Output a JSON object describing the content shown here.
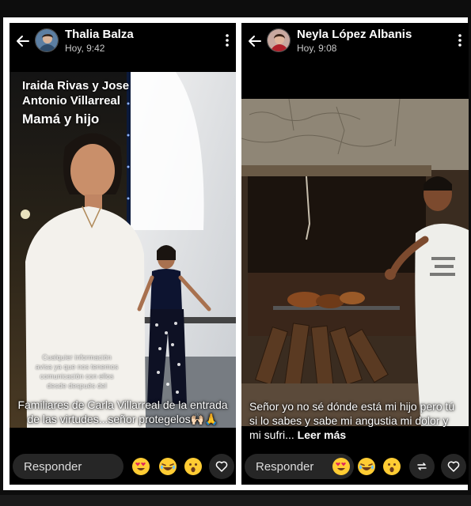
{
  "left_story": {
    "user_name": "Thalia Balza",
    "time": "Hoy, 9:42",
    "overlay_names": "Iraida Rivas y Jose Antonio Villarreal",
    "overlay_subtitle": "Mamá y hijo",
    "overlay_note": "Cualquier información avisa ya que nos tenemos comunicación con ellos desde después del",
    "caption": "Familiares de Carla Villarreal de la entrada de las virtudes...señor protegelos🙌🏻🙏",
    "reply_label": "Responder",
    "reactions": [
      "heart-eyes-emoji",
      "laughing-emoji",
      "surprised-emoji"
    ],
    "buttons": [
      "heart-icon"
    ]
  },
  "right_story": {
    "user_name": "Neyla López Albanis",
    "time": "Hoy, 9:08",
    "caption": "Señor yo no sé dónde está mi hijo pero tú si lo sabes y sabe mi angustia mi dolor y mi sufri...",
    "read_more": "Leer más",
    "reply_label": "Responder",
    "reactions": [
      "heart-eyes-emoji",
      "laughing-emoji",
      "surprised-emoji"
    ],
    "buttons": [
      "repost-icon",
      "heart-icon"
    ]
  },
  "colors": {
    "background": "#0d0d0d",
    "frame": "#ffffff",
    "panel": "#000000",
    "pill": "#262626",
    "text": "#ffffff",
    "muted": "#c9c9c9"
  }
}
